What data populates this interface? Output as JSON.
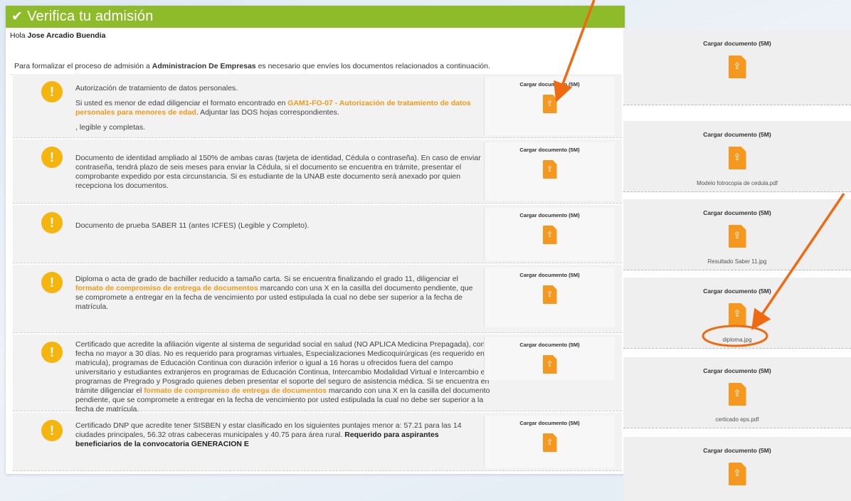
{
  "header": {
    "title": "Verifica tu admisión"
  },
  "greeting": {
    "prefix": "Hola",
    "name": "Jose Arcadio Buendia"
  },
  "intro": {
    "before": "Para formalizar el proceso de admisión a",
    "program": "Administracion De Empresas",
    "after": "es necesario que envíes los documentos relacionados a continuación."
  },
  "upload_label": "Cargar documento (5M)",
  "requirements": [
    {
      "p1": "Autorización de tratamiento de datos personales.",
      "p2_before": "Si usted es menor de edad diligenciar el formato encontrado en",
      "p2_link": "GAM1-FO-07 - Autorización de tratamiento de datos personales para menores de edad",
      "p2_after": ". Adjuntar las DOS hojas correspondientes.",
      "p3": ", legible y completas."
    },
    {
      "p1": "Documento de identidad ampliado al 150% de ambas caras (tarjeta de identidad, Cédula o contraseña). En caso de enviar contraseña, tendrá plazo de seis meses para enviar la Cédula, si el documento se encuentra en trámite, presentar el comprobante expedido por esta circunstancia. Si es estudiante de la UNAB este documento será anexado por quien recepciona los documentos."
    },
    {
      "p1": "Documento de prueba SABER 11 (antes ICFES) (Legible y Completo)."
    },
    {
      "p1_before": "Diploma o acta de grado de bachiller reducido a tamaño carta. Si se encuentra finalizando el grado 11, diligenciar el",
      "p1_link": "formato de compromiso de entrega de documentos",
      "p1_after": "marcando con una X en la casilla del documento pendiente, que se compromete a entregar en la fecha de vencimiento por usted estipulada la cual no debe ser superior a la fecha de matrícula."
    },
    {
      "p1_before": "Certificado que acredite la afiliación vigente al sistema de seguridad social en salud (NO APLICA Medicina Prepagada), con fecha no mayor a 30 días. No es requerido para programas virtuales, Especializaciones Medicoquirúrgicas (es requerido en la matricula), programas de Educación Continua con duración inferior o igual a 16 horas u ofrecidos fuera del campo universitario y estudiantes extranjeros en programas de Educación Continua, Intercambio Modalidad Virtual e Intercambio en programas de Pregrado y Posgrado quienes deben presentar el soporte del seguro de asistencia médica. Si se encuentra en trámite diligenciar el",
      "p1_link": "formato de compromiso de entrega de documentos",
      "p1_after": "marcando con una X en la casilla del documento pendiente, que se compromete a entregar en la fecha de vencimiento por usted estipulada la cual no debe ser superior a la fecha de matrícula."
    },
    {
      "p1_before": "Certificado DNP que acredite tener SISBEN y estar clasificado en los siguientes puntajes menor a: 57.21 para las 14 ciudades principales, 56.32 otras cabeceras municipales y 40.75 para área rural.",
      "p1_bold": "Requerido para aspirantes beneficiarios de la convocatoria GENERACION E"
    }
  ],
  "side_cards": [
    {
      "file": ""
    },
    {
      "file": "Modelo fotrocopia de cedula.pdf"
    },
    {
      "file": "Resultado Saber 11.jpg"
    },
    {
      "file": "diploma.jpg"
    },
    {
      "file": "certicado eps.pdf"
    },
    {
      "file": ""
    }
  ],
  "colors": {
    "header_green": "#8dbb2a",
    "warning_yellow": "#f5b50f",
    "upload_orange": "#f59820",
    "link_orange": "#f39a17",
    "annotation_orange": "#f06a12"
  }
}
